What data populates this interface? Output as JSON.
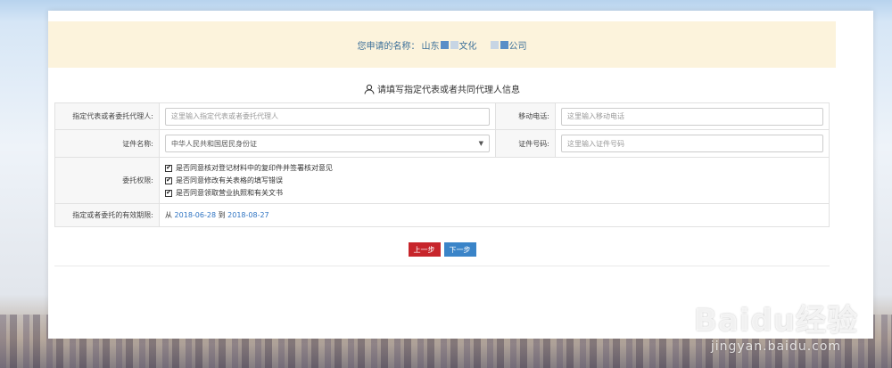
{
  "banner": {
    "label": "您申请的名称：",
    "name_part1": "山东",
    "name_part2": "文化",
    "name_part3": "公司"
  },
  "heading": {
    "text": "请填写指定代表或者共同代理人信息",
    "icon": "user-icon"
  },
  "form": {
    "agent_label": "指定代表或者委托代理人:",
    "agent_placeholder": "这里输入指定代表或者委托代理人",
    "mobile_label": "移动电话:",
    "mobile_placeholder": "这里输入移动电话",
    "id_type_label": "证件名称:",
    "id_type_value": "中华人民共和国居民身份证",
    "id_no_label": "证件号码:",
    "id_no_placeholder": "这里输入证件号码",
    "auth_label": "委托权限:",
    "permissions": [
      "是否同意核对登记材料中的复印件并签署核对意见",
      "是否同意修改有关表格的填写错误",
      "是否同意领取营业执照和有关文书"
    ],
    "validity_label": "指定或者委托的有效期限:",
    "from_label": "从",
    "from_date": "2018-06-28",
    "to_label": "到",
    "to_date": "2018-08-27"
  },
  "buttons": {
    "prev": "上一步",
    "next": "下一步"
  },
  "watermark": {
    "main": "Baidu经验",
    "sub": "jingyan.baidu.com"
  },
  "colors": {
    "accent": "#3a84c8",
    "danger": "#c7252b",
    "banner_bg": "#fcf3dc"
  }
}
